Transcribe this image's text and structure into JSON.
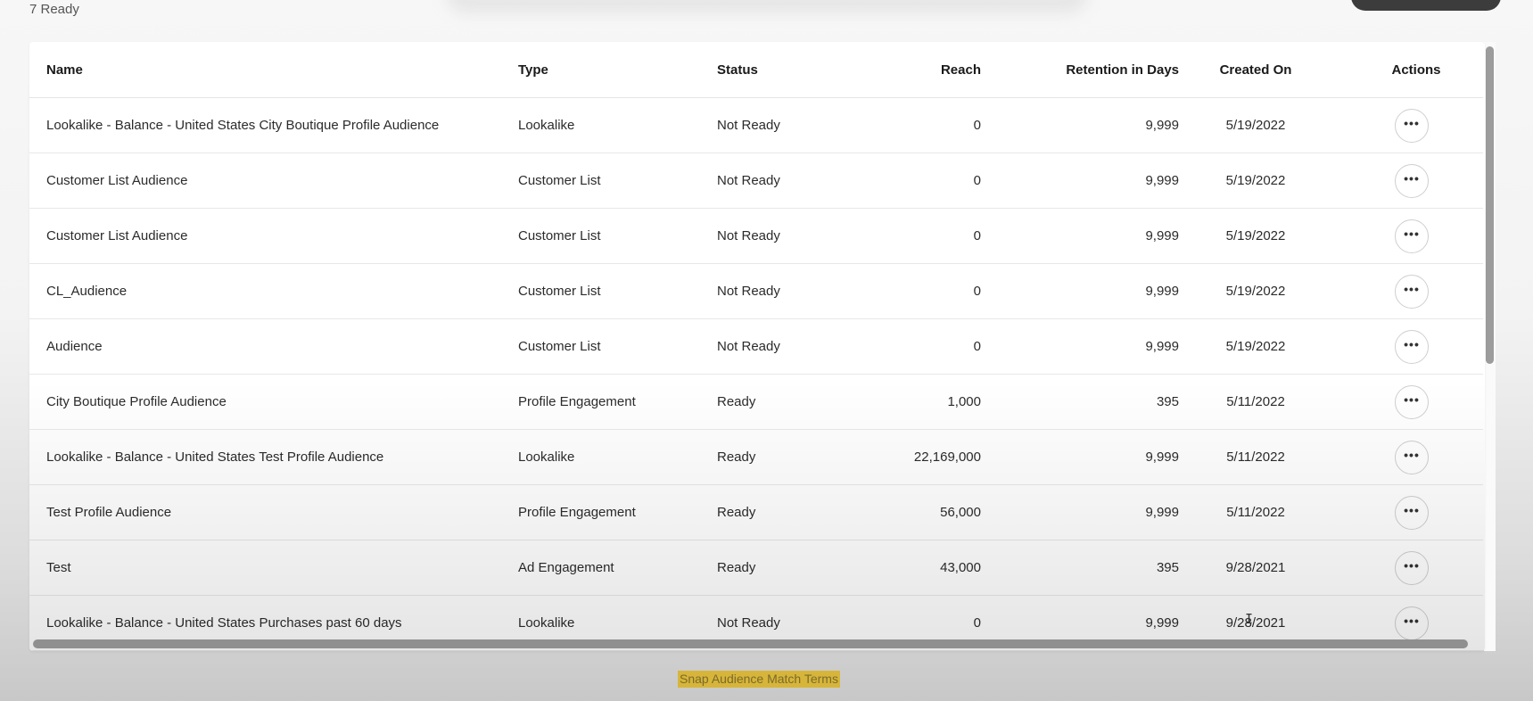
{
  "header": {
    "ready_count": "7 Ready"
  },
  "table": {
    "columns": {
      "name": "Name",
      "type": "Type",
      "status": "Status",
      "reach": "Reach",
      "retention": "Retention in Days",
      "created": "Created On",
      "actions": "Actions"
    },
    "action_glyph": "•••",
    "rows": [
      {
        "name": "Lookalike - Balance - United States City Boutique Profile Audience",
        "type": "Lookalike",
        "status": "Not Ready",
        "reach": "0",
        "retention": "9,999",
        "created": "5/19/2022"
      },
      {
        "name": "Customer List Audience",
        "type": "Customer List",
        "status": "Not Ready",
        "reach": "0",
        "retention": "9,999",
        "created": "5/19/2022"
      },
      {
        "name": "Customer List Audience",
        "type": "Customer List",
        "status": "Not Ready",
        "reach": "0",
        "retention": "9,999",
        "created": "5/19/2022"
      },
      {
        "name": "CL_Audience",
        "type": "Customer List",
        "status": "Not Ready",
        "reach": "0",
        "retention": "9,999",
        "created": "5/19/2022"
      },
      {
        "name": "Audience",
        "type": "Customer List",
        "status": "Not Ready",
        "reach": "0",
        "retention": "9,999",
        "created": "5/19/2022"
      },
      {
        "name": "City Boutique Profile Audience",
        "type": "Profile Engagement",
        "status": "Ready",
        "reach": "1,000",
        "retention": "395",
        "created": "5/11/2022"
      },
      {
        "name": "Lookalike - Balance - United States Test Profile Audience",
        "type": "Lookalike",
        "status": "Ready",
        "reach": "22,169,000",
        "retention": "9,999",
        "created": "5/11/2022"
      },
      {
        "name": "Test Profile Audience",
        "type": "Profile Engagement",
        "status": "Ready",
        "reach": "56,000",
        "retention": "9,999",
        "created": "5/11/2022"
      },
      {
        "name": "Test",
        "type": "Ad Engagement",
        "status": "Ready",
        "reach": "43,000",
        "retention": "395",
        "created": "9/28/2021"
      },
      {
        "name": "Lookalike - Balance - United States Purchases past 60 days",
        "type": "Lookalike",
        "status": "Not Ready",
        "reach": "0",
        "retention": "9,999",
        "created": "9/28/2021"
      }
    ]
  },
  "footer": {
    "caption": "Snap Audience Match Terms"
  }
}
